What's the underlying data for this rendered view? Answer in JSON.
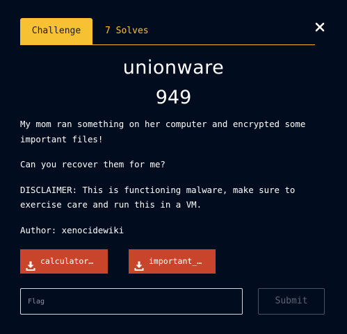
{
  "tabs": {
    "challenge_label": "Challenge",
    "solves_label": "7 Solves"
  },
  "challenge": {
    "name": "unionware",
    "points": "949",
    "description": [
      "My mom ran something on her computer and encrypted some important files!",
      "Can you recover them for me?",
      "DISCLAIMER: This is functioning malware, make sure to exercise care and run this in a VM.",
      "Author: xenocidewiki"
    ]
  },
  "files": [
    {
      "label": "calculator…",
      "icon": "download-icon"
    },
    {
      "label": "important_…",
      "icon": "download-icon"
    }
  ],
  "form": {
    "flag_placeholder": "Flag",
    "flag_value": "",
    "submit_label": "Submit"
  },
  "colors": {
    "background": "#020c1f",
    "tab_accent": "#f7c134",
    "file_button": "#c8442a"
  },
  "icons": {
    "close": "close-icon",
    "download": "download-icon"
  }
}
